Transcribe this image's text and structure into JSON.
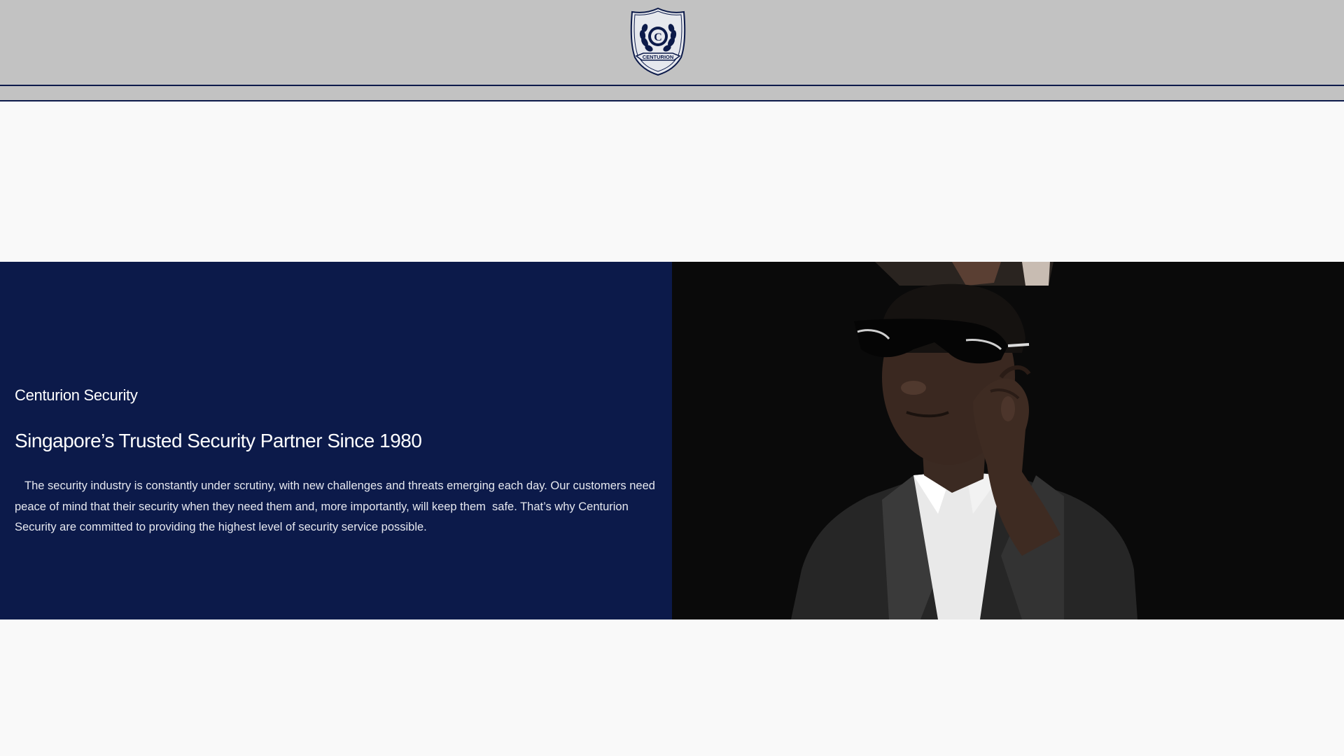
{
  "header": {
    "logo_text": "CENTURION",
    "logo_icon": "shield-crest-icon"
  },
  "hero": {
    "brand": "Centurion Security",
    "title": "Singapore’s Trusted Security Partner Since 1980",
    "body": "The security industry is constantly under scrutiny, with new challenges and threats emerging each day. Our customers need peace of mind that their security when they need them and, more importantly, will keep them  safe. That’s why Centurion Security are committed to providing the highest level of security service possible.",
    "image_icon": "security-guard-photo"
  },
  "colors": {
    "header_bg": "#c2c2c2",
    "navy": "#0c1a4a",
    "page_bg": "#f9f9f9",
    "photo_bg": "#0a0a0a"
  }
}
